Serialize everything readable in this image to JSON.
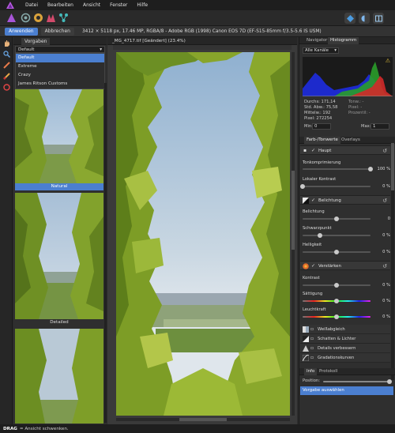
{
  "menubar": {
    "items": [
      "Datei",
      "Bearbeiten",
      "Ansicht",
      "Fenster",
      "Hilfe"
    ]
  },
  "context_toolbar": {
    "apply_label": "Anwenden",
    "cancel_label": "Abbrechen",
    "info": "3412 × 5118 px, 17.46 MP, RGBA/8 - Adobe RGB (1998)    Canon EOS 7D (EF-S15-85mm f/3.5-5.6 IS USM)"
  },
  "presets": {
    "tab_label": "Vorgaben",
    "selected": "Default",
    "options": [
      "Default",
      "Extreme",
      "Crazy",
      "James Ritson Customs"
    ],
    "thumbs": [
      {
        "label": "Natural",
        "selected": true
      },
      {
        "label": "Detailed",
        "selected": false
      }
    ]
  },
  "document": {
    "tab_title": "_MG_4717.tif [Geändert] (23.4%)"
  },
  "navigator": {
    "tabs": [
      "Navigator",
      "Histogramm"
    ],
    "channel": "Alle Kanäle",
    "stats": {
      "mean": "Durchs: 171,14",
      "stddev": "Std. Abw.: 75,58",
      "median": "Mittelw.: 192",
      "pixels": "Pixel: 272254",
      "tone": "Tonw.: -",
      "pixel": "Pixel: -",
      "percent": "Prozentil: -"
    },
    "min_label": "Min:",
    "min_value": "0",
    "max_label": "Max:",
    "max_value": "1"
  },
  "adjust": {
    "tabs": [
      "Farb-/Tonwerte",
      "Overlays"
    ],
    "section_main": "Haupt",
    "tonecompress_label": "Tonkomprimierung",
    "tonecompress_value": "100 %",
    "tonecompress_level": 100,
    "localcontrast_label": "Lokaler Kontrast",
    "localcontrast_value": "0 %",
    "localcontrast_level": 0,
    "section_exposure": "Belichtung",
    "exposure_label": "Belichtung",
    "exposure_value": "0",
    "exposure_level": 50,
    "blackpoint_label": "Schwarzpunkt",
    "blackpoint_value": "0 %",
    "blackpoint_level": 25,
    "brightness_label": "Helligkeit",
    "brightness_value": "0 %",
    "brightness_level": 50,
    "section_enhance": "Verstärken",
    "contrast_label": "Kontrast",
    "contrast_value": "0 %",
    "contrast_level": 50,
    "saturation_label": "Sättigung",
    "saturation_value": "0 %",
    "saturation_level": 50,
    "vibrance_label": "Leuchtkraft",
    "vibrance_value": "0 %",
    "vibrance_level": 50,
    "rows": [
      "Weißabgleich",
      "Schatten & Lichter",
      "Details verbessern",
      "Gradationskurven"
    ]
  },
  "info_panel": {
    "tabs": [
      "Info",
      "Protokoll"
    ],
    "position_label": "Position:",
    "history_item": "Vorgabe auswählen"
  },
  "status": {
    "mode": "DRAG",
    "text": "= Ansicht schwenken."
  },
  "colors": {
    "accent": "#4b7fd0"
  }
}
